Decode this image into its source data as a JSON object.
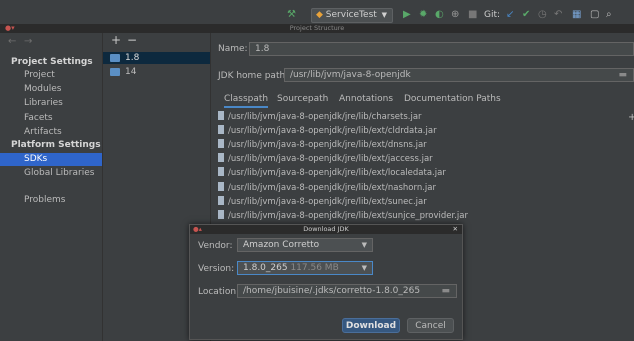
{
  "toolbar": {
    "run_config": "ServiceTest",
    "git_label": "Git:"
  },
  "window": {
    "title": "Project Structure"
  },
  "nav": {
    "project_settings_header": "Project Settings",
    "project_settings_items": [
      "Project",
      "Modules",
      "Libraries",
      "Facets",
      "Artifacts"
    ],
    "platform_settings_header": "Platform Settings",
    "platform_settings_items": [
      "SDKs",
      "Global Libraries"
    ],
    "problems": "Problems",
    "selected": "SDKs"
  },
  "sdk_list": {
    "add_symbol": "+",
    "remove_symbol": "−",
    "items": [
      "1.8",
      "14"
    ],
    "selected": "1.8"
  },
  "detail": {
    "name_label": "Name:",
    "name_value": "1.8",
    "jdk_home_label": "JDK home path:",
    "jdk_home_value": "/usr/lib/jvm/java-8-openjdk",
    "tabs": [
      "Classpath",
      "Sourcepath",
      "Annotations",
      "Documentation Paths"
    ],
    "active_tab": "Classpath",
    "classpath": [
      "/usr/lib/jvm/java-8-openjdk/jre/lib/charsets.jar",
      "/usr/lib/jvm/java-8-openjdk/jre/lib/ext/cldrdata.jar",
      "/usr/lib/jvm/java-8-openjdk/jre/lib/ext/dnsns.jar",
      "/usr/lib/jvm/java-8-openjdk/jre/lib/ext/jaccess.jar",
      "/usr/lib/jvm/java-8-openjdk/jre/lib/ext/localedata.jar",
      "/usr/lib/jvm/java-8-openjdk/jre/lib/ext/nashorn.jar",
      "/usr/lib/jvm/java-8-openjdk/jre/lib/ext/sunec.jar",
      "/usr/lib/jvm/java-8-openjdk/jre/lib/ext/sunjce_provider.jar"
    ]
  },
  "dialog": {
    "title": "Download JDK",
    "vendor_label": "Vendor:",
    "vendor_value": "Amazon Corretto",
    "version_label": "Version:",
    "version_value": "1.8.0_265",
    "version_size": "117.56 MB",
    "location_label": "Location:",
    "location_value": "/home/jbuisine/.jdks/corretto-1.8.0_265",
    "download_button": "Download",
    "cancel_button": "Cancel"
  },
  "colors": {
    "background": "#3c3f41",
    "selection": "#2f65ca",
    "primary_button": "#365880",
    "run_green": "#59a869"
  }
}
